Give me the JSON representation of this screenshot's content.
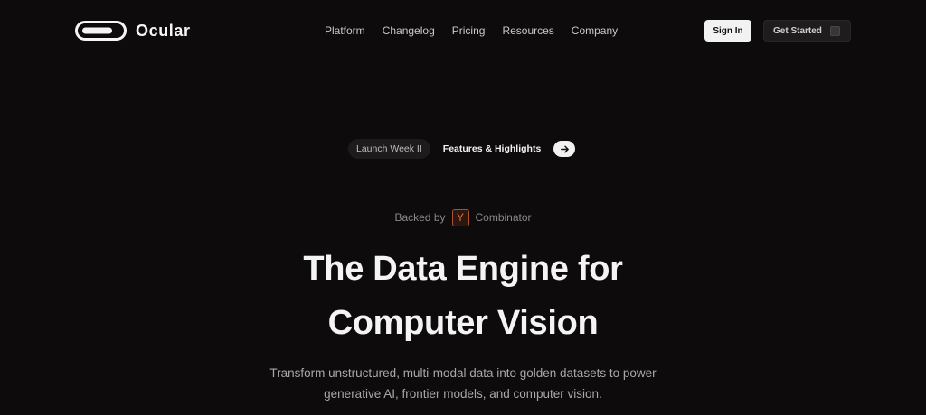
{
  "brand": {
    "name": "Ocular",
    "logo_icon": "pill-toggle-icon"
  },
  "nav": {
    "items": [
      {
        "label": "Platform"
      },
      {
        "label": "Changelog"
      },
      {
        "label": "Pricing"
      },
      {
        "label": "Resources"
      },
      {
        "label": "Company"
      }
    ]
  },
  "header_actions": {
    "sign_in": "Sign In",
    "get_started": "Get Started"
  },
  "announcement": {
    "tag": "Launch Week II",
    "link": "Features & Highlights",
    "arrow_icon": "arrow-right-icon"
  },
  "backed_by": {
    "prefix": "Backed by",
    "badge": "Y",
    "suffix": "Combinator",
    "badge_color": "#e86d3e"
  },
  "hero": {
    "title_line1": "The Data Engine for",
    "title_line2": "Computer Vision",
    "subtitle_line1": "Transform unstructured, multi-modal data into golden datasets to power",
    "subtitle_line2": "generative AI, frontier models, and computer vision."
  },
  "colors": {
    "background": "#0d0b0c",
    "primary_button": "#f2f2f2",
    "secondary_button": "#1f1c1e"
  }
}
